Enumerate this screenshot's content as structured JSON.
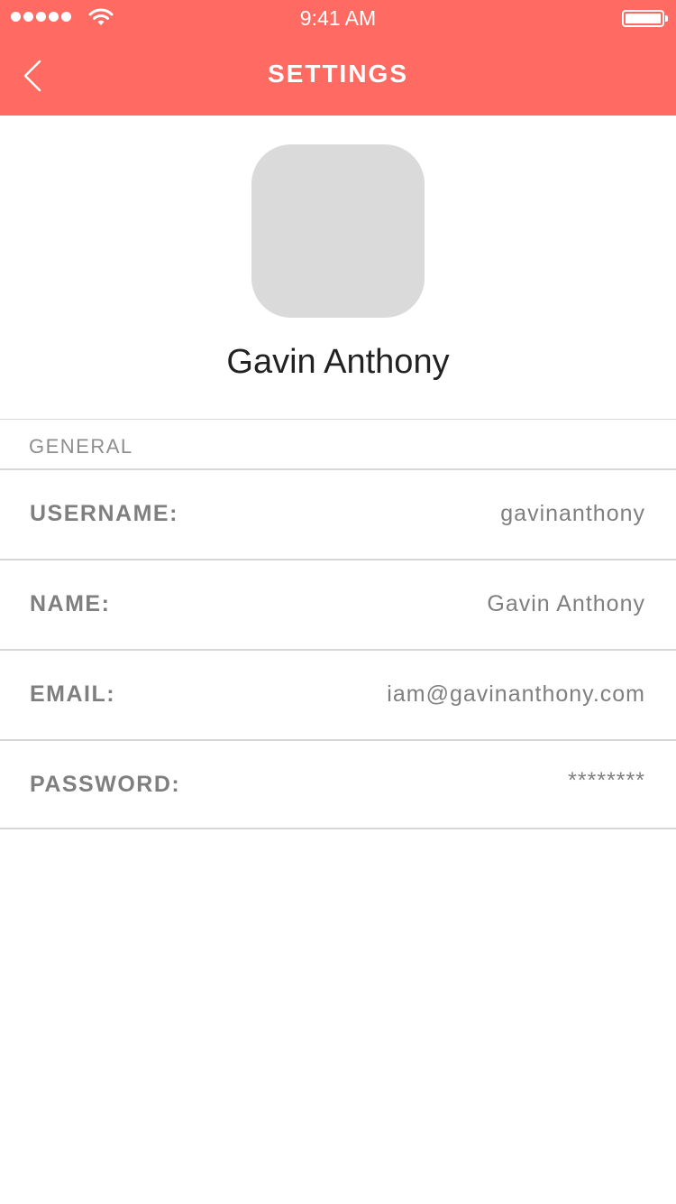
{
  "status_bar": {
    "time": "9:41 AM"
  },
  "header": {
    "title": "SETTINGS",
    "back_icon": "chevron-left-icon",
    "background": "#ff6b63"
  },
  "profile": {
    "name": "Gavin Anthony"
  },
  "section": {
    "title": "GENERAL"
  },
  "fields": [
    {
      "label": "USERNAME:",
      "value": "gavinanthony"
    },
    {
      "label": "NAME:",
      "value": "Gavin Anthony"
    },
    {
      "label": "EMAIL:",
      "value": "iam@gavinanthony.com"
    },
    {
      "label": "PASSWORD:",
      "value": "********"
    }
  ]
}
